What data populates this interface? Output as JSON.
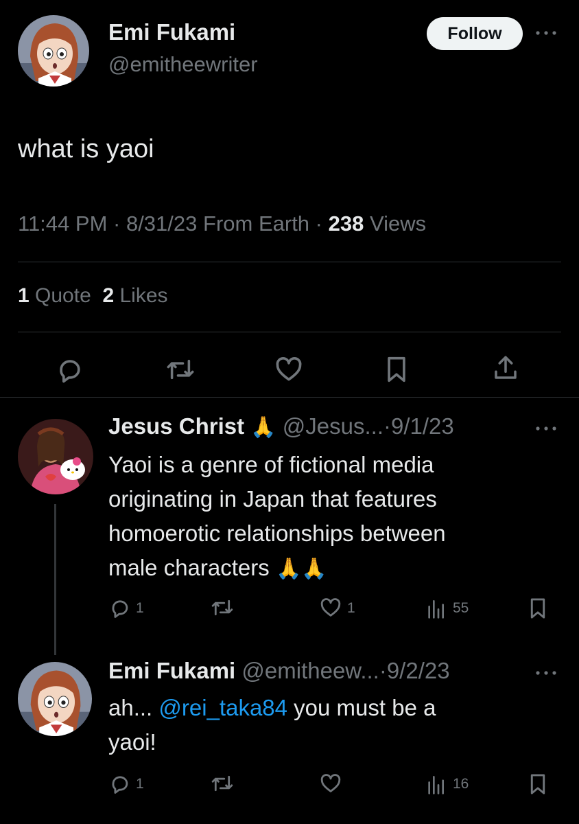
{
  "tweet": {
    "author_name": "Emi Fukami",
    "author_handle": "@emitheewriter",
    "follow_label": "Follow",
    "text": "what is yaoi",
    "time": "11:44 PM",
    "date": "8/31/23",
    "source": "From Earth",
    "views_count": "238",
    "views_label": "Views",
    "quotes_count": "1",
    "quotes_label": "Quote",
    "likes_count": "2",
    "likes_label": "Likes",
    "actions": [
      "reply-icon",
      "retweet-icon",
      "like-icon",
      "bookmark-icon",
      "share-icon"
    ]
  },
  "replies": [
    {
      "author_name": "Jesus Christ",
      "name_emoji": "🙏",
      "handle": "@Jesus...",
      "date": "9/1/23",
      "lines": [
        "Yaoi is a genre of fictional media",
        "originating in Japan that features",
        "homoerotic relationships between",
        "male characters"
      ],
      "trail_emoji": "🙏🙏",
      "reply_count": "1",
      "like_count": "1",
      "view_count": "55"
    },
    {
      "author_name": "Emi Fukami",
      "handle": "@emitheew...",
      "date": "9/2/23",
      "text_before": "ah...",
      "mention": "@rei_taka84",
      "text_after": "you must be a",
      "line2": "yaoi!",
      "reply_count": "1",
      "view_count": "16"
    }
  ],
  "colors": {
    "background": "#000000",
    "text": "#e7e9ea",
    "secondary": "#71767b",
    "link": "#1d9bf0",
    "divider": "#2f3336"
  }
}
